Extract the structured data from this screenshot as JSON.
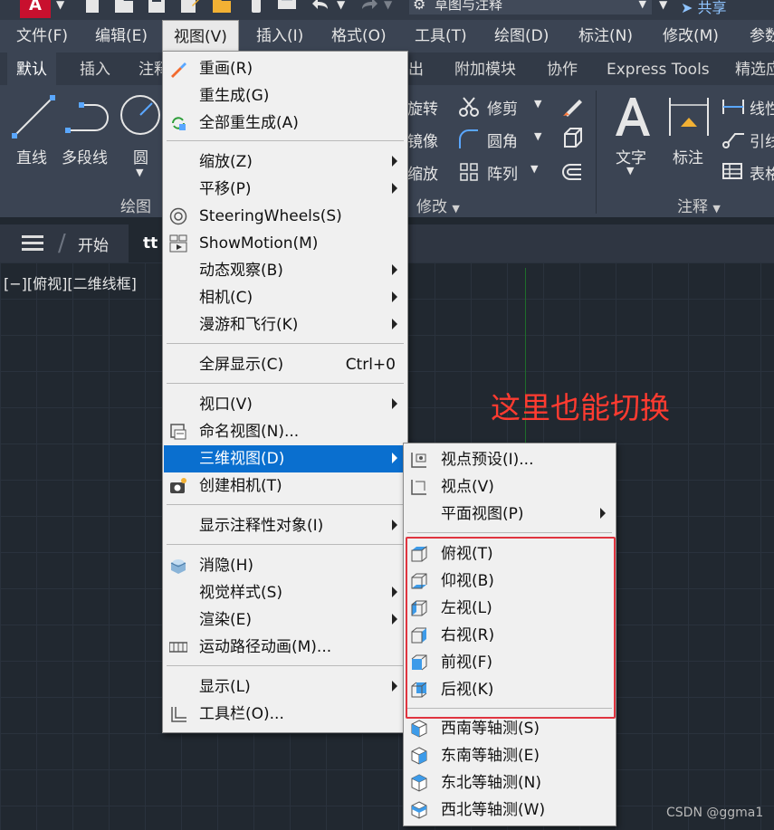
{
  "workspace": {
    "name": "草图与注释",
    "share_label": "共享"
  },
  "menubar": {
    "items": [
      {
        "label": "文件(F)"
      },
      {
        "label": "编辑(E)"
      },
      {
        "label": "视图(V)"
      },
      {
        "label": "插入(I)"
      },
      {
        "label": "格式(O)"
      },
      {
        "label": "工具(T)"
      },
      {
        "label": "绘图(D)"
      },
      {
        "label": "标注(N)"
      },
      {
        "label": "修改(M)"
      },
      {
        "label": "参数"
      }
    ]
  },
  "ribbon_tabs": [
    {
      "label": "默认"
    },
    {
      "label": "插入"
    },
    {
      "label": "注释"
    },
    {
      "label": "输出"
    },
    {
      "label": "附加模块"
    },
    {
      "label": "协作"
    },
    {
      "label": "Express Tools"
    },
    {
      "label": "精选应"
    }
  ],
  "ribbon": {
    "draw": {
      "line": "直线",
      "polyline": "多段线",
      "circle": "圆",
      "title": "绘图"
    },
    "modify": {
      "rotate": "旋转",
      "trim": "修剪",
      "mirror": "镜像",
      "fillet": "圆角",
      "scale": "缩放",
      "array": "阵列",
      "title": "修改"
    },
    "annotation": {
      "text": "文字",
      "dimension": "标注",
      "linear": "线性",
      "leader": "引线",
      "table": "表格",
      "title": "注释"
    }
  },
  "doc_tabs": {
    "start": "开始",
    "active": "tt"
  },
  "viewport": {
    "label": "[−][俯视][二维线框]"
  },
  "annotation_text": "这里也能切换",
  "watermark": "CSDN @ggma1",
  "view_menu": {
    "items": [
      {
        "label": "重画(R)",
        "icon": "redraw-icon"
      },
      {
        "label": "重生成(G)"
      },
      {
        "label": "全部重生成(A)",
        "icon": "regen-all-icon"
      },
      {
        "label": "缩放(Z)"
      },
      {
        "label": "平移(P)"
      },
      {
        "label": "SteeringWheels(S)",
        "icon": "steering-wheel-icon"
      },
      {
        "label": "ShowMotion(M)",
        "icon": "showmotion-icon"
      },
      {
        "label": "动态观察(B)"
      },
      {
        "label": "相机(C)"
      },
      {
        "label": "漫游和飞行(K)"
      },
      {
        "label": "全屏显示(C)",
        "shortcut": "Ctrl+0"
      },
      {
        "label": "视口(V)"
      },
      {
        "label": "命名视图(N)...",
        "icon": "named-view-icon"
      },
      {
        "label": "三维视图(D)"
      },
      {
        "label": "创建相机(T)",
        "icon": "camera-icon"
      },
      {
        "label": "显示注释性对象(I)"
      },
      {
        "label": "消隐(H)",
        "icon": "hide-icon"
      },
      {
        "label": "视觉样式(S)"
      },
      {
        "label": "渲染(E)"
      },
      {
        "label": "运动路径动画(M)...",
        "icon": "motion-path-icon"
      },
      {
        "label": "显示(L)"
      },
      {
        "label": "工具栏(O)...",
        "icon": "toolbar-icon"
      }
    ]
  },
  "submenu_3d_views": {
    "items": [
      {
        "label": "视点预设(I)...",
        "icon": "viewpoint-preset-icon"
      },
      {
        "label": "视点(V)",
        "icon": "viewpoint-icon"
      },
      {
        "label": "平面视图(P)"
      },
      {
        "label": "俯视(T)",
        "icon": "top-view-icon"
      },
      {
        "label": "仰视(B)",
        "icon": "bottom-view-icon"
      },
      {
        "label": "左视(L)",
        "icon": "left-view-icon"
      },
      {
        "label": "右视(R)",
        "icon": "right-view-icon"
      },
      {
        "label": "前视(F)",
        "icon": "front-view-icon"
      },
      {
        "label": "后视(K)",
        "icon": "back-view-icon"
      },
      {
        "label": "西南等轴测(S)",
        "icon": "sw-iso-icon"
      },
      {
        "label": "东南等轴测(E)",
        "icon": "se-iso-icon"
      },
      {
        "label": "东北等轴测(N)",
        "icon": "ne-iso-icon"
      },
      {
        "label": "西北等轴测(W)",
        "icon": "nw-iso-icon"
      }
    ]
  },
  "colors": {
    "highlight": "#0a6fcf",
    "annotation": "#ff3b30",
    "app_brand": "#c8102e"
  }
}
